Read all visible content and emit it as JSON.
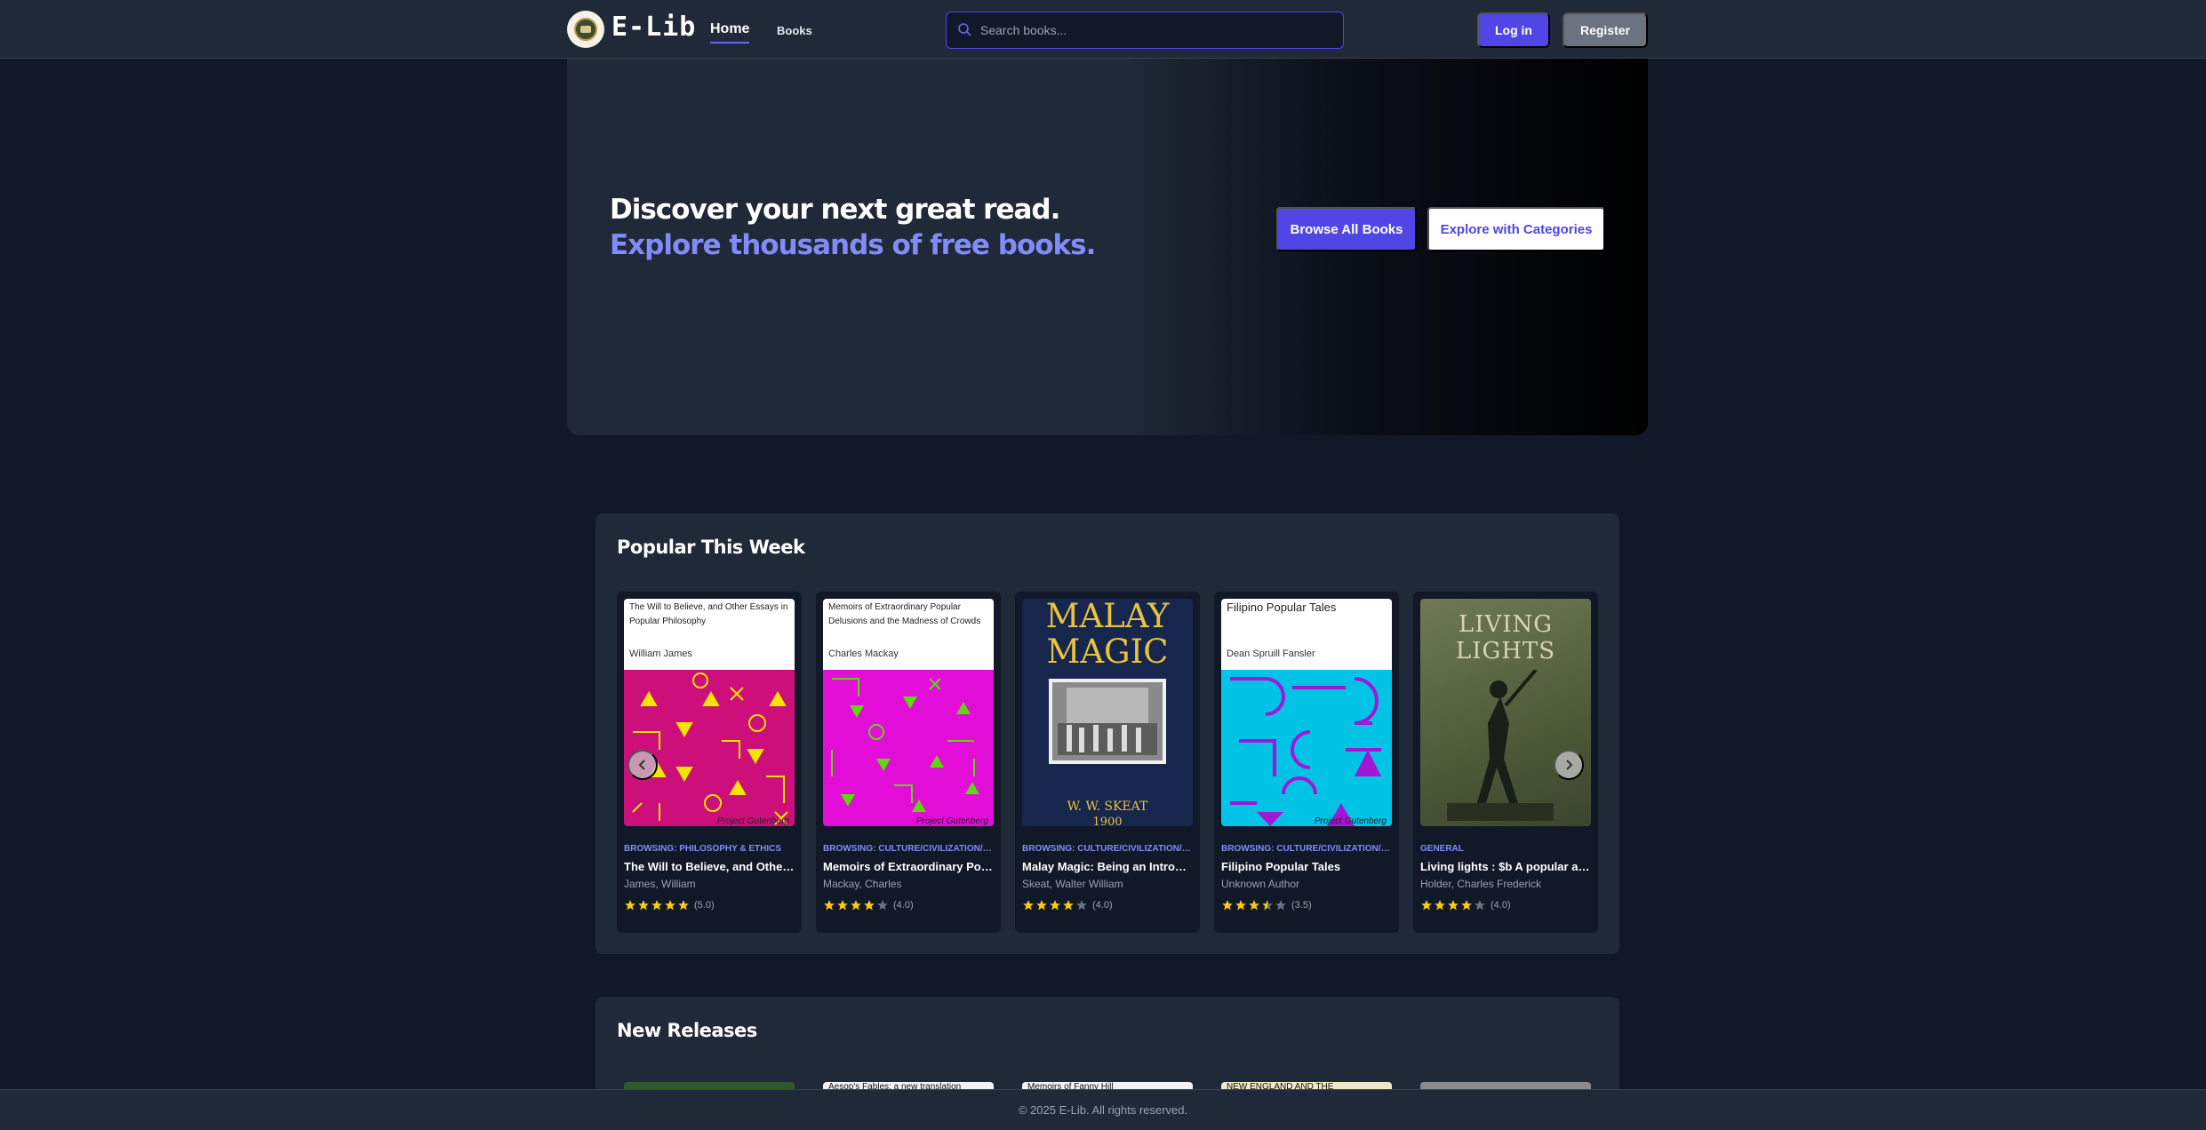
{
  "nav": {
    "brand": "E-Lib",
    "links": [
      {
        "label": "Home",
        "active": true
      },
      {
        "label": "Books",
        "active": false
      }
    ],
    "search_placeholder": "Search books...",
    "login_label": "Log in",
    "register_label": "Register"
  },
  "hero": {
    "line1": "Discover your next great read.",
    "line2": "Explore thousands of free books.",
    "browse_label": "Browse All Books",
    "explore_label": "Explore with Categories"
  },
  "popular": {
    "title": "Popular This Week",
    "books": [
      {
        "cover_title": "The Will to Believe, and Other Essays in Popular Philosophy",
        "cover_author": "William James",
        "cover_footer": "Project Gutenberg",
        "genre": "BROWSING: PHILOSOPHY & ETHICS",
        "title": "The Will to Believe, and Other Essays in Popular Philosophy",
        "author": "James, William",
        "rating": 5.0,
        "rating_label": "(5.0)"
      },
      {
        "cover_title": "Memoirs of Extraordinary Popular Delusions and the Madness of Crowds",
        "cover_author": "Charles Mackay",
        "cover_footer": "Project Gutenberg",
        "genre": "BROWSING: CULTURE/CIVILIZATION/SOCIETY",
        "title": "Memoirs of Extraordinary Popular Delusions",
        "author": "Mackay, Charles",
        "rating": 4.0,
        "rating_label": "(4.0)"
      },
      {
        "cover_title": "MALAY MAGIC",
        "cover_author": "W. W. SKEAT",
        "cover_footer": "1900",
        "genre": "BROWSING: CULTURE/CIVILIZATION/SOCIETY",
        "title": "Malay Magic: Being an Introduction",
        "author": "Skeat, Walter William",
        "rating": 4.0,
        "rating_label": "(4.0)"
      },
      {
        "cover_title": "Filipino Popular Tales",
        "cover_author": "Dean Spruill Fansler",
        "cover_footer": "Project Gutenberg",
        "genre": "BROWSING: CULTURE/CIVILIZATION/SOCIETY",
        "title": "Filipino Popular Tales",
        "author": "Unknown Author",
        "rating": 3.5,
        "rating_label": "(3.5)"
      },
      {
        "cover_title": "LIVING LIGHTS",
        "cover_author": "",
        "cover_footer": "",
        "genre": "GENERAL",
        "title": "Living lights : $b A popular account",
        "author": "Holder, Charles Frederick",
        "rating": 4.0,
        "rating_label": "(4.0)"
      }
    ]
  },
  "releases": {
    "title": "New Releases",
    "covers": [
      "",
      "Aesop's Fables: a new translation",
      "Memoirs of Fanny Hill",
      "NEW ENGLAND AND THE",
      ""
    ]
  },
  "footer": {
    "text": "© 2025 E-Lib. All rights reserved."
  },
  "colors": {
    "accent": "#4f46e5",
    "accent_light": "#818cf8",
    "bg": "#111827",
    "panel": "#1f2937",
    "star": "#facc15"
  }
}
